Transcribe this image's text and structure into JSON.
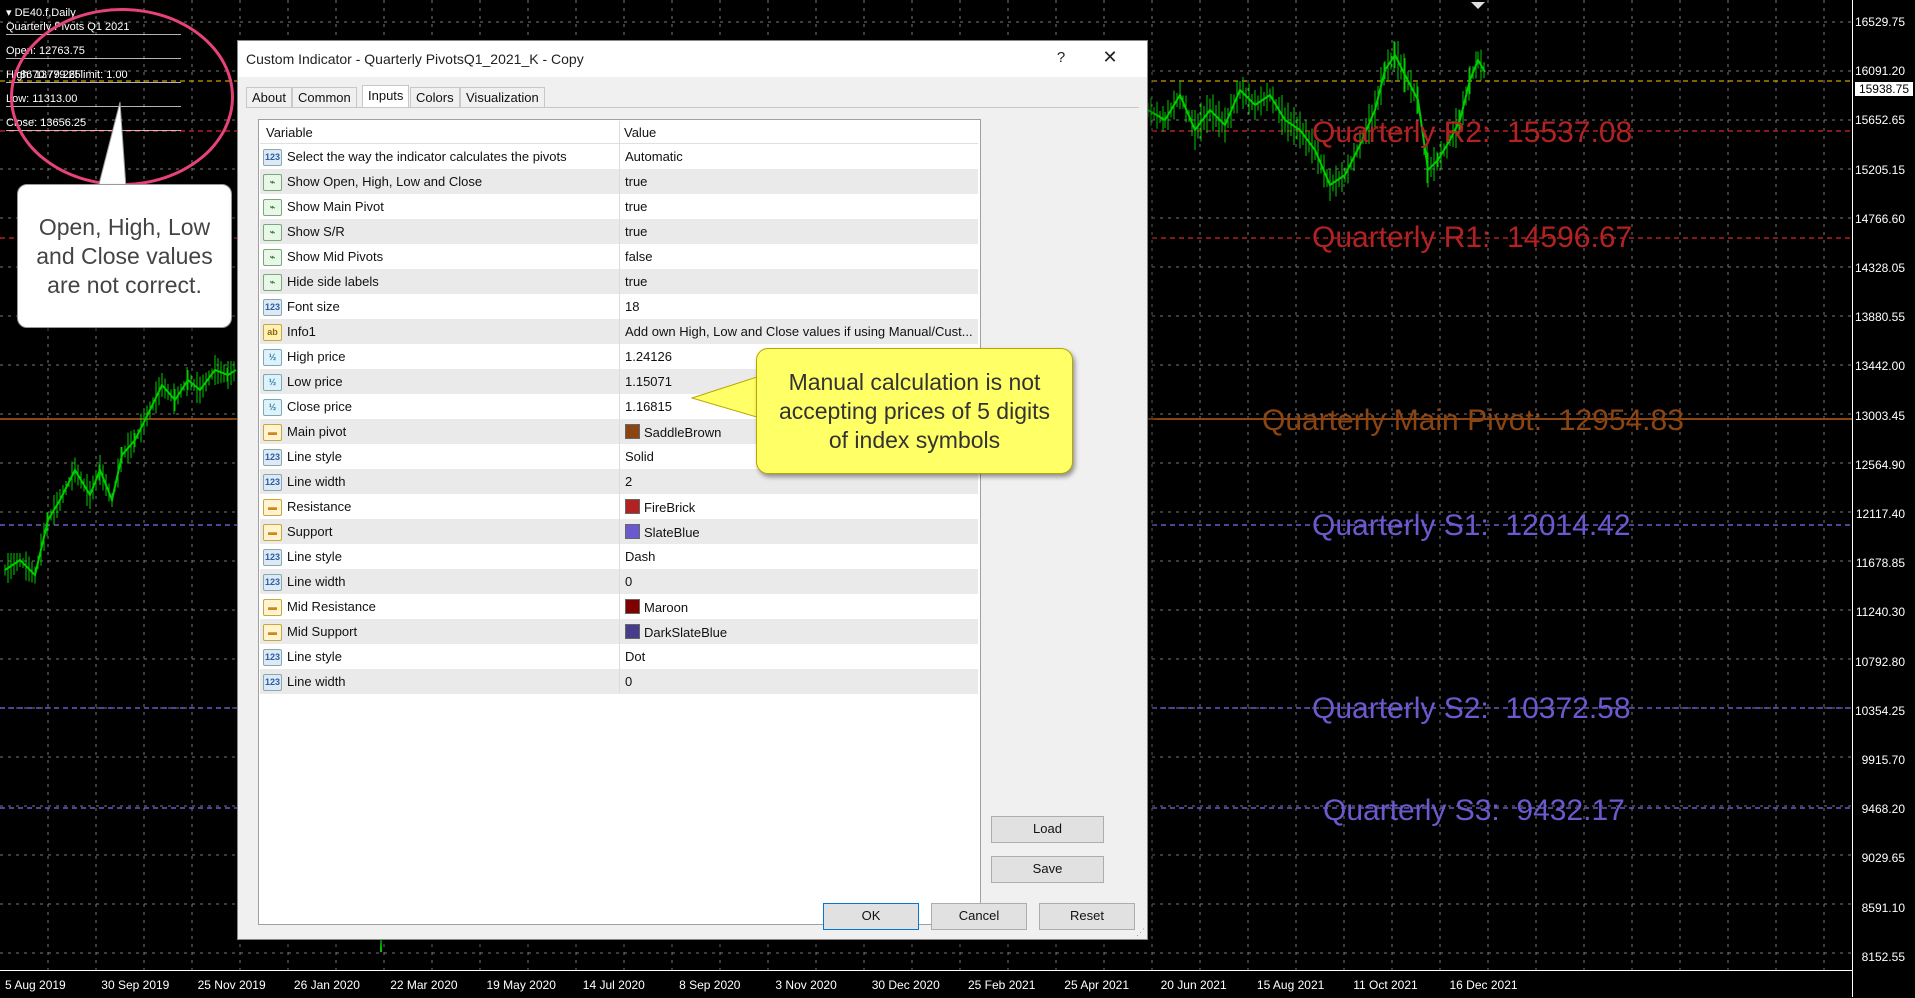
{
  "chart": {
    "symbol": "DE40.f,Daily",
    "indicator_name": "Quarterly Pivots Q1 2021",
    "info_open": "Open: 12763.75",
    "info_high": "High: 13779.25",
    "info_overlay": "8670.79.26l limit: 1.00",
    "info_low": "Low: 11313.00",
    "info_close": "Close: 13656.25",
    "current_price": "15938.75",
    "price_ticks": [
      "16529.75",
      "16091.20",
      "15652.65",
      "15205.15",
      "14766.60",
      "14328.05",
      "13880.55",
      "13442.00",
      "13003.45",
      "12564.90",
      "12117.40",
      "11678.85",
      "11240.30",
      "10792.80",
      "10354.25",
      "9915.70",
      "9468.20",
      "9029.65",
      "8591.10",
      "8152.55"
    ],
    "date_ticks": [
      "5 Aug 2019",
      "30 Sep 2019",
      "25 Nov 2019",
      "26 Jan 2020",
      "22 Mar 2020",
      "19 May 2020",
      "14 Jul 2020",
      "8 Sep 2020",
      "3 Nov 2020",
      "30 Dec 2020",
      "25 Feb 2021",
      "25 Apr 2021",
      "20 Jun 2021",
      "15 Aug 2021",
      "11 Oct 2021",
      "16 Dec 2021"
    ],
    "pivots": [
      {
        "label": "Quarterly R2:  15537.08",
        "color": "#b22222"
      },
      {
        "label": "Quarterly R1:  14596.67",
        "color": "#b22222"
      },
      {
        "label": "Quarterly Main Pivot:  12954.83",
        "color": "#8b4513"
      },
      {
        "label": "Quarterly S1:  12014.42",
        "color": "#6a5acd"
      },
      {
        "label": "Quarterly S2:  10372.58",
        "color": "#6a5acd"
      },
      {
        "label": "Quarterly S3:  9432.17",
        "color": "#6a5acd"
      }
    ],
    "candle_color": "#00cc00"
  },
  "annotations": {
    "white_callout": "Open, High, Low and Close values are not correct.",
    "yellow_callout": "Manual calculation is not accepting prices of 5 digits of index symbols"
  },
  "dialog": {
    "title": "Custom Indicator - Quarterly PivotsQ1_2021_K - Copy",
    "help": "?",
    "close": "✕",
    "tabs": [
      "About",
      "Common",
      "Inputs",
      "Colors",
      "Visualization"
    ],
    "active_tab": "Inputs",
    "columns": {
      "variable": "Variable",
      "value": "Value"
    },
    "rows": [
      {
        "icon": "123",
        "kind": "int",
        "variable": "Select the way the indicator calculates the pivots",
        "value": "Automatic"
      },
      {
        "icon": "bool",
        "kind": "bool",
        "variable": "Show Open, High, Low and Close",
        "value": "true"
      },
      {
        "icon": "bool",
        "kind": "bool",
        "variable": "Show Main Pivot",
        "value": "true"
      },
      {
        "icon": "bool",
        "kind": "bool",
        "variable": "Show S/R",
        "value": "true"
      },
      {
        "icon": "bool",
        "kind": "bool",
        "variable": "Show Mid Pivots",
        "value": "false"
      },
      {
        "icon": "bool",
        "kind": "bool",
        "variable": "Hide side labels",
        "value": "true"
      },
      {
        "icon": "123",
        "kind": "int",
        "variable": "Font size",
        "value": "18"
      },
      {
        "icon": "ab",
        "kind": "str",
        "variable": "Info1",
        "value": "Add own High, Low and Close values if using Manual/Cust..."
      },
      {
        "icon": "½",
        "kind": "dbl",
        "variable": "High price",
        "value": "1.24126"
      },
      {
        "icon": "½",
        "kind": "dbl",
        "variable": "Low price",
        "value": "1.15071"
      },
      {
        "icon": "½",
        "kind": "dbl",
        "variable": "Close price",
        "value": "1.16815"
      },
      {
        "icon": "clr",
        "kind": "clr",
        "variable": "Main pivot",
        "value": "SaddleBrown",
        "swatch": "#8b4513"
      },
      {
        "icon": "123",
        "kind": "int",
        "variable": "Line style",
        "value": "Solid"
      },
      {
        "icon": "123",
        "kind": "int",
        "variable": "Line width",
        "value": "2"
      },
      {
        "icon": "clr",
        "kind": "clr",
        "variable": "Resistance",
        "value": "FireBrick",
        "swatch": "#b22222"
      },
      {
        "icon": "clr",
        "kind": "clr",
        "variable": "Support",
        "value": "SlateBlue",
        "swatch": "#6a5acd"
      },
      {
        "icon": "123",
        "kind": "int",
        "variable": "Line style",
        "value": "Dash"
      },
      {
        "icon": "123",
        "kind": "int",
        "variable": "Line width",
        "value": "0"
      },
      {
        "icon": "clr",
        "kind": "clr",
        "variable": "Mid Resistance",
        "value": "Maroon",
        "swatch": "#800000"
      },
      {
        "icon": "clr",
        "kind": "clr",
        "variable": "Mid Support",
        "value": "DarkSlateBlue",
        "swatch": "#483d8b"
      },
      {
        "icon": "123",
        "kind": "int",
        "variable": "Line style",
        "value": "Dot"
      },
      {
        "icon": "123",
        "kind": "int",
        "variable": "Line width",
        "value": "0"
      }
    ],
    "buttons": {
      "load": "Load",
      "save": "Save",
      "ok": "OK",
      "cancel": "Cancel",
      "reset": "Reset"
    }
  }
}
